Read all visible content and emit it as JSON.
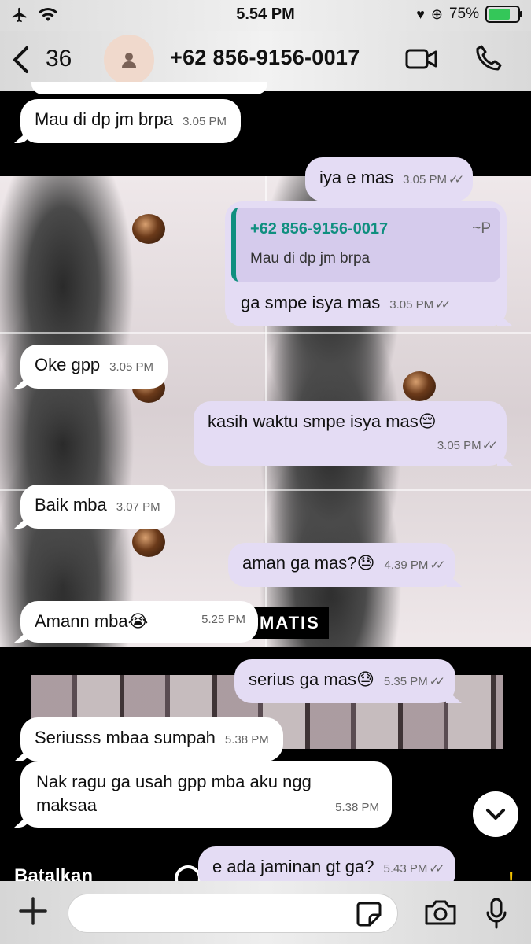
{
  "status_bar": {
    "time": "5.54 PM",
    "battery": "75%"
  },
  "header": {
    "back_count": "36",
    "contact": "+62 856-9156-0017"
  },
  "messages": [
    {
      "dir": "in",
      "text": "Mau di dp jm brpa",
      "time": "3.05 PM"
    },
    {
      "dir": "out",
      "text": "iya e mas",
      "time": "3.05 PM"
    },
    {
      "dir": "out",
      "quote_name": "+62 856-9156-0017",
      "quote_tag": "~P",
      "quote_text": "Mau di dp jm brpa",
      "text": "ga smpe isya mas",
      "time": "3.05 PM"
    },
    {
      "dir": "in",
      "text": "Oke gpp",
      "time": "3.05 PM"
    },
    {
      "dir": "out",
      "text": "kasih waktu smpe isya mas😔",
      "time": "3.05 PM"
    },
    {
      "dir": "in",
      "text": "Baik mba",
      "time": "3.07 PM"
    },
    {
      "dir": "out",
      "text": "aman ga mas?😓",
      "time": "4.39 PM"
    },
    {
      "dir": "in",
      "text": "Amann mba😭",
      "time": "5.25 PM"
    },
    {
      "dir": "out",
      "text": "serius ga mas😓",
      "time": "5.35 PM"
    },
    {
      "dir": "in",
      "text": "Seriusss mbaa sumpah",
      "time": "5.38 PM"
    },
    {
      "dir": "in",
      "text": "Nak ragu ga usah gpp mba aku ngg maksaa",
      "time": "5.38 PM"
    },
    {
      "dir": "out",
      "text": "e ada jaminan gt ga?",
      "time": "5.43 PM"
    }
  ],
  "wallpaper": {
    "overlay_text": "MATIS",
    "bottom_text": "Batalkan"
  },
  "icons": {
    "back": "chevron-left-icon",
    "video": "video-call-icon",
    "phone": "phone-call-icon",
    "scroll": "chevron-down-icon",
    "plus": "plus-icon",
    "sticker": "sticker-icon",
    "camera": "camera-icon",
    "mic": "microphone-icon"
  },
  "colors": {
    "incoming_bubble": "#ffffff",
    "outgoing_bubble": "#e4dcf4",
    "quote_accent": "#0f8f7f",
    "battery_fill": "#34c759"
  }
}
